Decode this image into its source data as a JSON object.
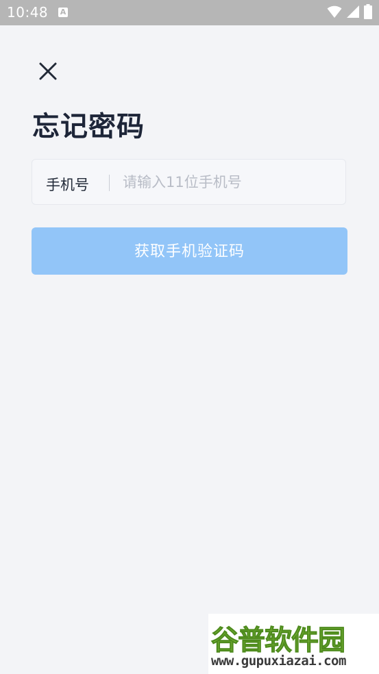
{
  "status_bar": {
    "time": "10:48",
    "notification_badge": "A",
    "icons": [
      "wifi-icon",
      "signal-icon",
      "battery-icon"
    ]
  },
  "header": {
    "close_icon": "close-icon",
    "title": "忘记密码"
  },
  "form": {
    "phone_label": "手机号",
    "phone_value": "",
    "phone_placeholder": "请输入11位手机号",
    "submit_label": "获取手机验证码"
  },
  "watermark": {
    "title": "谷普软件园",
    "url": "www.gupuxiazai.com"
  },
  "colors": {
    "background": "#f3f4f7",
    "button_disabled": "#92c5f8",
    "title_text": "#1d2538",
    "placeholder": "#b8bcc6",
    "status_bar": "#b6b6b6"
  }
}
